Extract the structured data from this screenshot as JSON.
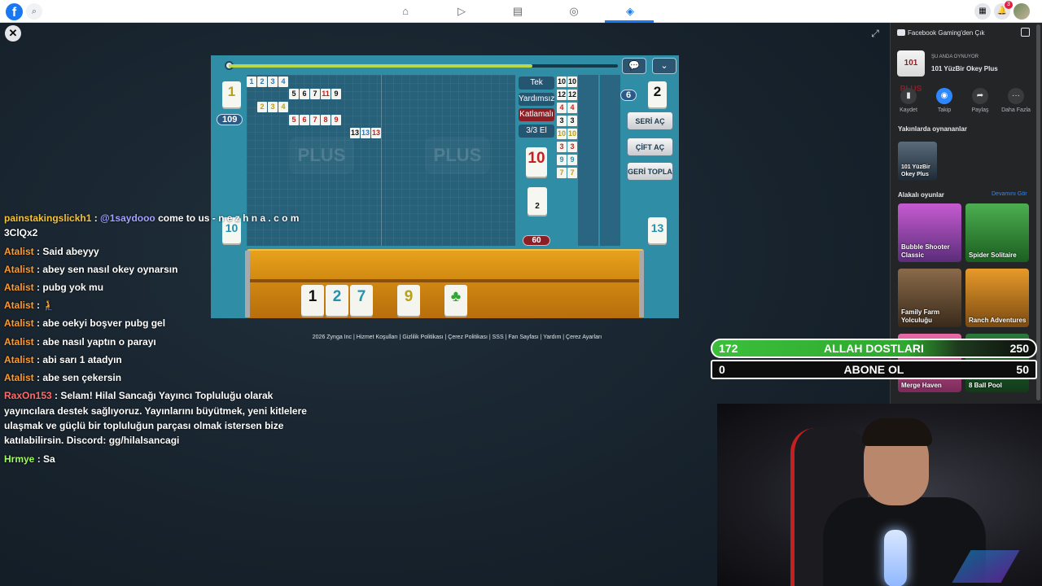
{
  "topbar": {
    "logo": "f",
    "nav_icons": [
      "home-icon",
      "watch-icon",
      "marketplace-icon",
      "groups-icon",
      "gaming-icon"
    ],
    "notification_count": "3"
  },
  "game": {
    "progress_fraction": 0.78,
    "counters": {
      "pool": "109",
      "left_tile": "1",
      "left_bottom": "10",
      "right_pill": "6",
      "right_tile": "2",
      "right_bottom": "13",
      "center_big": "10",
      "center_small": "2",
      "score": "60"
    },
    "info_buttons": [
      "Tek",
      "Yardımsız",
      "Katlamalı",
      "3/3 El"
    ],
    "action_buttons": [
      "SERİ AÇ",
      "ÇİFT AÇ",
      "GERİ TOPLA"
    ],
    "board_rows": [
      {
        "tiles": [
          {
            "n": "1",
            "c": "blue"
          },
          {
            "n": "2",
            "c": "blue"
          },
          {
            "n": "3",
            "c": "blue"
          },
          {
            "n": "4",
            "c": "blue"
          }
        ]
      },
      {
        "tiles": [
          {
            "n": "5",
            "c": "black"
          },
          {
            "n": "6",
            "c": "black"
          },
          {
            "n": "7",
            "c": "black"
          },
          {
            "n": "11",
            "c": "red"
          },
          {
            "n": "9",
            "c": "black"
          }
        ]
      },
      {
        "tiles": [
          {
            "n": "2",
            "c": "yellow"
          },
          {
            "n": "3",
            "c": "yellow"
          },
          {
            "n": "4",
            "c": "yellow"
          }
        ]
      },
      {
        "tiles": [
          {
            "n": "5",
            "c": "red"
          },
          {
            "n": "6",
            "c": "red"
          },
          {
            "n": "7",
            "c": "red"
          },
          {
            "n": "8",
            "c": "red"
          },
          {
            "n": "9",
            "c": "red"
          }
        ]
      },
      {
        "tiles": [
          {
            "n": "13",
            "c": "black"
          },
          {
            "n": "13",
            "c": "blue"
          },
          {
            "n": "13",
            "c": "red"
          }
        ]
      }
    ],
    "side_pairs": [
      {
        "n": "10",
        "c": "black"
      },
      {
        "n": "12",
        "c": "black"
      },
      {
        "n": "4",
        "c": "red"
      },
      {
        "n": "3",
        "c": "black"
      },
      {
        "n": "10",
        "c": "yellow"
      },
      {
        "n": "3",
        "c": "red"
      },
      {
        "n": "9",
        "c": "teal"
      },
      {
        "n": "7",
        "c": "yellow"
      }
    ],
    "hand": [
      {
        "n": "1",
        "c": "black"
      },
      {
        "n": "2",
        "c": "teal"
      },
      {
        "n": "7",
        "c": "teal"
      },
      {
        "n": "9",
        "c": "yellow"
      },
      {
        "n": "♣",
        "c": "green"
      }
    ],
    "footer": "2026 Zynga Inc | Hizmet Koşulları | Gizlilik Politikası | Çerez Politikası | SSS | Fan Sayfası | Yardım | Çerez Ayarları"
  },
  "chat": [
    {
      "user": "painstakingslickh1",
      "text": "come to us - n e z h n a . c o m 3ClQx2",
      "mention": "@1saydooo",
      "cls": "u-pain"
    },
    {
      "user": "Atalist",
      "text": "Said abeyyy",
      "cls": "u-atalist"
    },
    {
      "user": "Atalist",
      "text": "abey sen nasıl okey oynarsın",
      "cls": "u-atalist"
    },
    {
      "user": "Atalist",
      "text": "pubg yok mu",
      "cls": "u-atalist"
    },
    {
      "user": "Atalist",
      "text": "🧎",
      "cls": "u-atalist"
    },
    {
      "user": "Atalist",
      "text": "abe oekyi boşver pubg gel",
      "cls": "u-atalist"
    },
    {
      "user": "Atalist",
      "text": "abe nasıl yaptın o parayı",
      "cls": "u-atalist"
    },
    {
      "user": "Atalist",
      "text": "abi sarı 1 atadyın",
      "cls": "u-atalist"
    },
    {
      "user": "Atalist",
      "text": "abe sen çekersin",
      "cls": "u-atalist"
    },
    {
      "user": "RaxOn153",
      "text": "Selam! Hilal Sancağı Yayıncı Topluluğu olarak yayıncılara destek sağlıyoruz. Yayınlarını büyütmek, yeni kitlelere ulaşmak ve güçlü bir topluluğun parçası olmak istersen bize katılabilirsin. Discord: gg/hilalsancagi",
      "cls": "u-raxon"
    },
    {
      "user": "Hrmye",
      "text": "Sa",
      "cls": "u-hrmye"
    }
  ],
  "sidebar": {
    "title": "Facebook Gaming'den Çık",
    "now_playing": "ŞU ANDA OYNUYOR",
    "game_name": "101 YüzBir Okey Plus",
    "thumb_text": "101 PLUS",
    "actions": [
      {
        "label": "Kaydet",
        "icon": "bookmark-icon",
        "glyph": "▮"
      },
      {
        "label": "Takip",
        "icon": "follow-icon",
        "glyph": "◉"
      },
      {
        "label": "Paylaş",
        "icon": "share-icon",
        "glyph": "➦"
      },
      {
        "label": "Daha Fazla",
        "icon": "more-icon",
        "glyph": "···"
      }
    ],
    "recent_title": "Yakınlarda oynananlar",
    "recent_game": "101 YüzBir Okey Plus",
    "related_title": "Alakalı oyunlar",
    "see_more": "Devamını Gör",
    "related": [
      {
        "name": "Bubble Shooter Classic",
        "color1": "#c75bd1",
        "color2": "#5a2d7a"
      },
      {
        "name": "Spider Solitaire",
        "color1": "#4caf50",
        "color2": "#1b5e20"
      },
      {
        "name": "Family Farm Yolculuğu",
        "color1": "#8a6a4a",
        "color2": "#3a2a1a"
      },
      {
        "name": "Ranch Adventures",
        "color1": "#e89a2a",
        "color2": "#7a4a12"
      },
      {
        "name": "Merge Haven",
        "color1": "#e86aa6",
        "color2": "#7a2a5a"
      },
      {
        "name": "8 Ball Pool",
        "color1": "#2a7a3a",
        "color2": "#123a1a"
      }
    ]
  },
  "overlay": {
    "bar1": {
      "left": "172",
      "mid": "ALLAH DOSTLARI",
      "right": "250"
    },
    "bar2": {
      "left": "0",
      "mid": "ABONE OL",
      "right": "50"
    }
  },
  "colors": {
    "accent": "#1877f2",
    "game_bg": "#2f8ea6",
    "rack": "#d08811"
  }
}
